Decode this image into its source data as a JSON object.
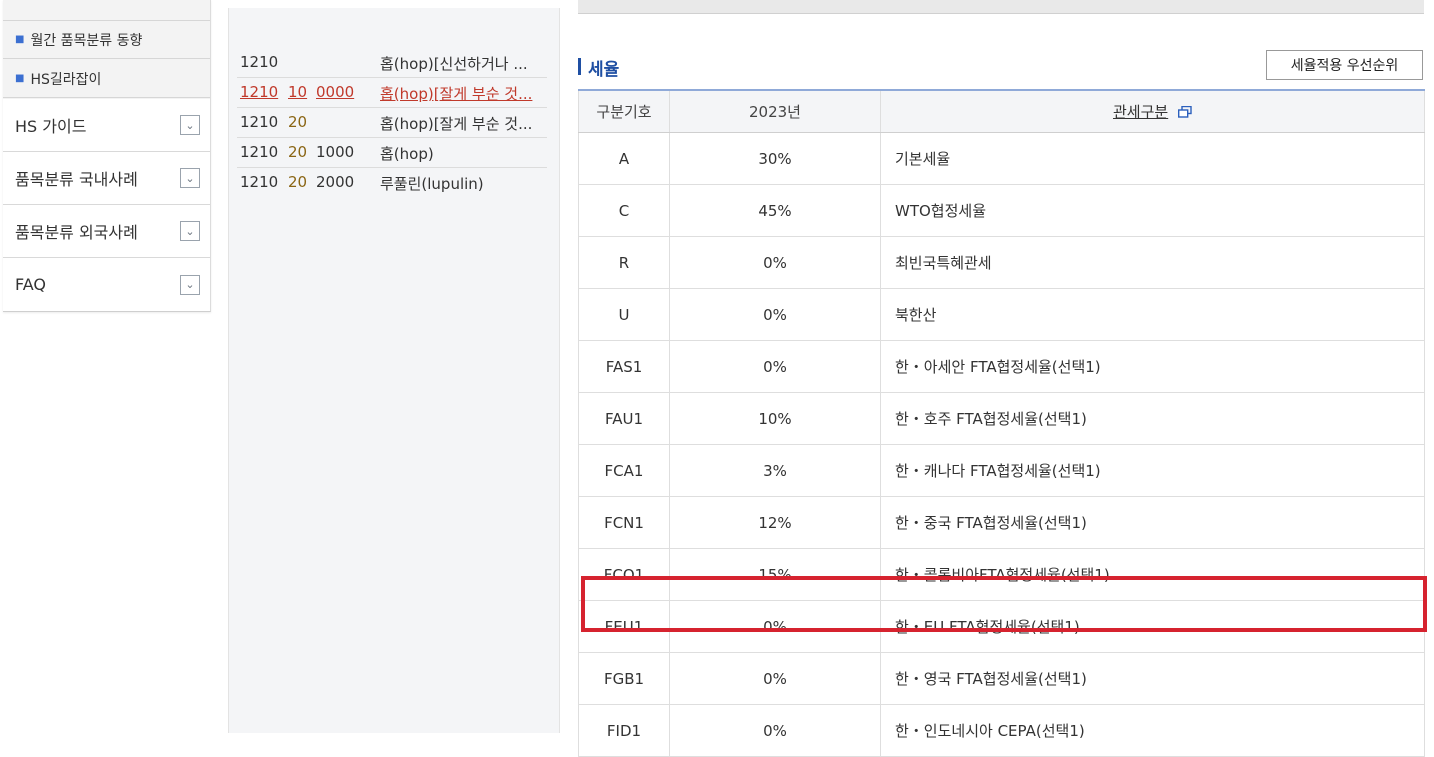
{
  "sidebar": {
    "sub_items": [
      {
        "label": "월간 품목분류 동향"
      },
      {
        "label": "HS길라잡이"
      }
    ],
    "sections": [
      {
        "label": "HS 가이드"
      },
      {
        "label": "품목분류 국내사례"
      },
      {
        "label": "품목분류 외국사례"
      },
      {
        "label": "FAQ"
      }
    ]
  },
  "hs_list": [
    {
      "c1": "1210",
      "c2": "",
      "c3": "",
      "desc": "홉(hop)[신선하거나 ..."
    },
    {
      "c1": "1210",
      "c2": "10",
      "c3": "0000",
      "desc": "홉(hop)[잘게 부순 것..."
    },
    {
      "c1": "1210",
      "c2": "20",
      "c3": "",
      "desc": "홉(hop)[잘게 부순 것..."
    },
    {
      "c1": "1210",
      "c2": "20",
      "c3": "1000",
      "desc": "홉(hop)"
    },
    {
      "c1": "1210",
      "c2": "20",
      "c3": "2000",
      "desc": "루풀린(lupulin)"
    }
  ],
  "rates": {
    "title": "세율",
    "priority_button": "세율적용 우선순위",
    "headers": {
      "code": "구분기호",
      "year": "2023년",
      "type": "관세구분"
    },
    "rows": [
      {
        "code": "A",
        "rate": "30%",
        "desc": "기본세율"
      },
      {
        "code": "C",
        "rate": "45%",
        "desc": "WTO협정세율"
      },
      {
        "code": "R",
        "rate": "0%",
        "desc": "최빈국특혜관세"
      },
      {
        "code": "U",
        "rate": "0%",
        "desc": "북한산"
      },
      {
        "code": "FAS1",
        "rate": "0%",
        "desc": "한・아세안 FTA협정세율(선택1)"
      },
      {
        "code": "FAU1",
        "rate": "10%",
        "desc": "한・호주 FTA협정세율(선택1)"
      },
      {
        "code": "FCA1",
        "rate": "3%",
        "desc": "한・캐나다 FTA협정세율(선택1)"
      },
      {
        "code": "FCN1",
        "rate": "12%",
        "desc": "한・중국 FTA협정세율(선택1)"
      },
      {
        "code": "FCO1",
        "rate": "15%",
        "desc": "한・콜롬비아FTA협정세율(선택1)"
      },
      {
        "code": "FEU1",
        "rate": "0%",
        "desc": "한・EU FTA협정세율(선택1)"
      },
      {
        "code": "FGB1",
        "rate": "0%",
        "desc": "한・영국 FTA협정세율(선택1)"
      },
      {
        "code": "FID1",
        "rate": "0%",
        "desc": "한・인도네시아 CEPA(선택1)"
      }
    ]
  },
  "colors": {
    "accent": "#1f4fa3",
    "highlight": "#d6232f",
    "active_link": "#c0392b"
  }
}
